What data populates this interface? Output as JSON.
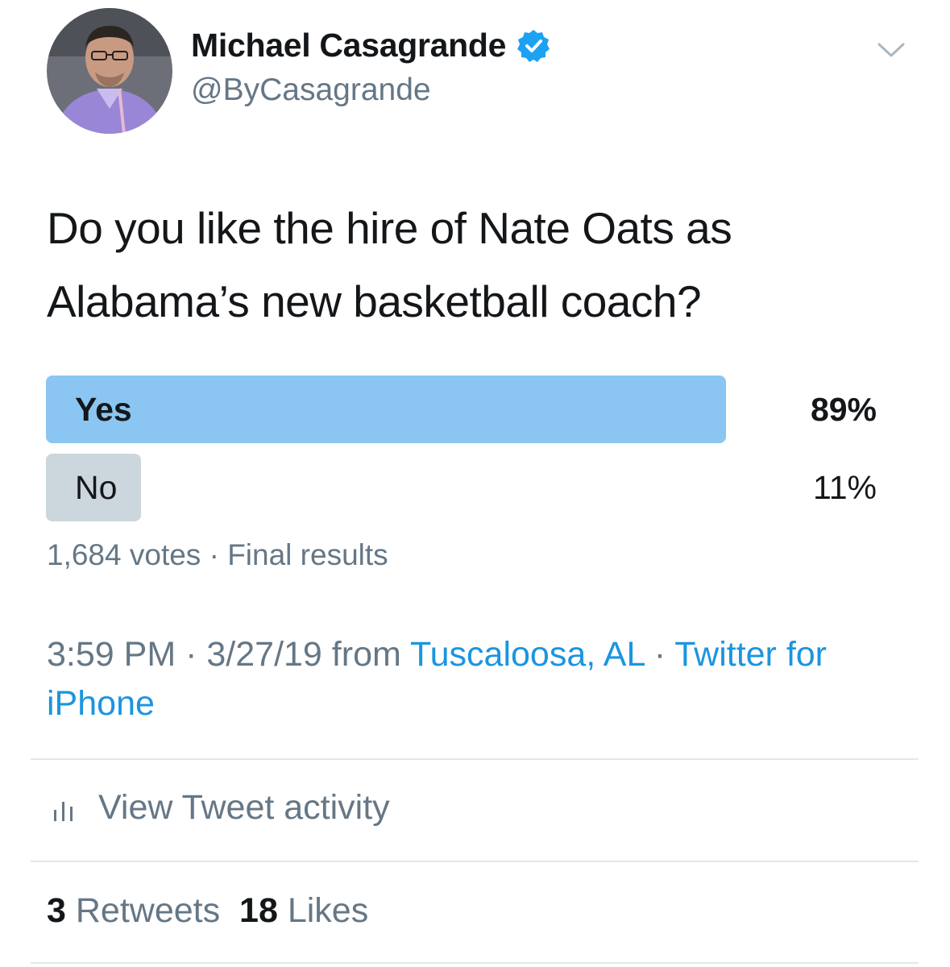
{
  "author": {
    "name": "Michael Casagrande",
    "handle": "@ByCasagrande",
    "verified": true
  },
  "tweet": {
    "text": "Do you like the hire of Nate Oats as Alabama’s new basketball coach?"
  },
  "poll": {
    "options": [
      {
        "label": "Yes",
        "percent_text": "89%",
        "percent": 89,
        "winner": true
      },
      {
        "label": "No",
        "percent_text": "11%",
        "percent": 11,
        "winner": false
      }
    ],
    "votes": "1,684 votes",
    "separator": "·",
    "status": "Final results"
  },
  "meta": {
    "time": "3:59 PM",
    "separator": "·",
    "date": "3/27/19",
    "from_word": "from",
    "location": "Tuscaloosa, AL",
    "source": "Twitter for iPhone"
  },
  "activity": {
    "label": "View Tweet activity"
  },
  "stats": {
    "retweets_count": "3",
    "retweets_label": "Retweets",
    "likes_count": "18",
    "likes_label": "Likes"
  },
  "icons": {
    "verified": "verified-badge-icon",
    "menu": "chevron-down-icon",
    "activity": "bar-chart-icon"
  },
  "colors": {
    "accent": "#1da1f2",
    "link": "#1b95e0",
    "winner_bar": "#8ac6f1",
    "loser_bar": "#ccd6dd",
    "secondary_text": "#657786",
    "primary_text": "#14171a",
    "divider": "#e1e8ed"
  }
}
